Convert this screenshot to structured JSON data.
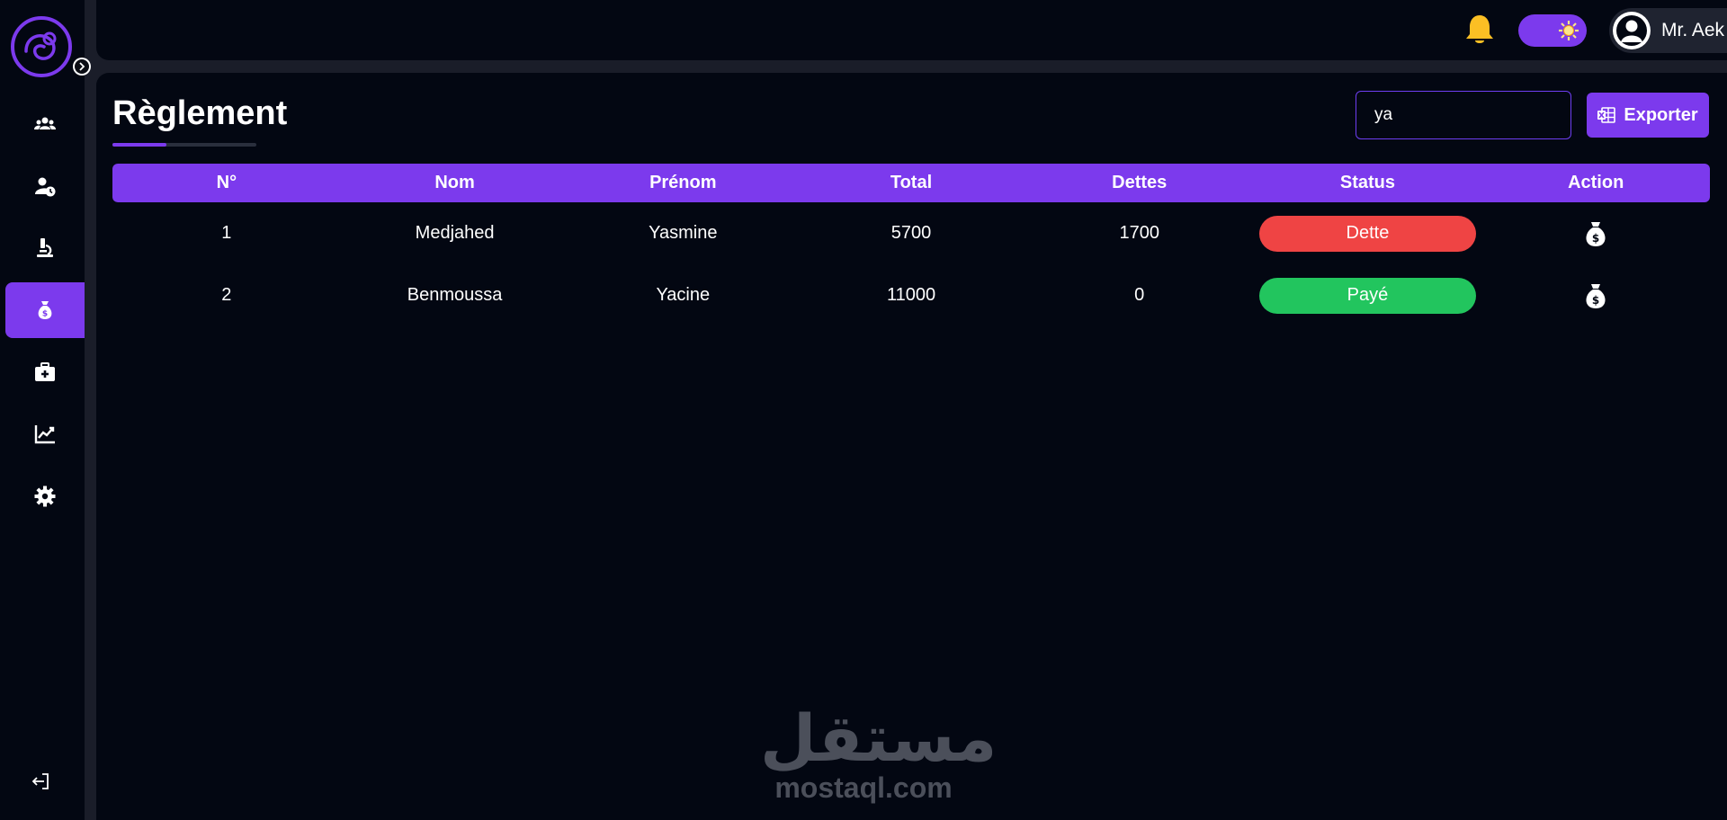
{
  "colors": {
    "accent": "#7c3aed",
    "debt": "#ef4444",
    "paid": "#22c55e",
    "bell": "#fbbf24"
  },
  "sidebar": {
    "items": [
      {
        "icon": "users-icon",
        "active": false
      },
      {
        "icon": "user-clock-icon",
        "active": false
      },
      {
        "icon": "microscope-icon",
        "active": false
      },
      {
        "icon": "money-bag-icon",
        "active": true
      },
      {
        "icon": "medical-kit-icon",
        "active": false
      },
      {
        "icon": "chart-line-icon",
        "active": false
      },
      {
        "icon": "gear-icon",
        "active": false
      }
    ],
    "logout_icon": "logout-icon"
  },
  "header": {
    "user_name": "Mr. Aek metlef"
  },
  "page": {
    "title": "Règlement",
    "search_value": "ya",
    "export_label": "Exporter"
  },
  "table": {
    "columns": [
      "N°",
      "Nom",
      "Prénom",
      "Total",
      "Dettes",
      "Status",
      "Action"
    ],
    "rows": [
      {
        "n": "1",
        "nom": "Medjahed",
        "prenom": "Yasmine",
        "total": "5700",
        "dettes": "1700",
        "status": "Dette",
        "status_type": "debt"
      },
      {
        "n": "2",
        "nom": "Benmoussa",
        "prenom": "Yacine",
        "total": "11000",
        "dettes": "0",
        "status": "Payé",
        "status_type": "paid"
      }
    ]
  },
  "watermark": {
    "arabic": "مستقل",
    "latin": "mostaql.com"
  }
}
